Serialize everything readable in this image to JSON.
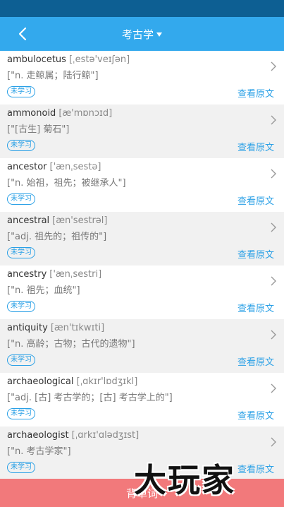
{
  "colors": {
    "status_bar": "#0d5f93",
    "nav_bar": "#33a9ed",
    "accent": "#2aa0e6",
    "bottom_button": "#f2797b",
    "alt_row": "#f1f1f1"
  },
  "nav": {
    "title": "考古学",
    "back_icon": "chevron-left-icon",
    "dropdown_icon": "caret-down-icon"
  },
  "words": [
    {
      "word": "ambulocetus",
      "phonetic": "[ˌestə'veɪʃən]",
      "meaning": "[\"n. 走鲸属；陆行鲸\"]",
      "status": "未学习",
      "link": "查看原文"
    },
    {
      "word": "ammonoid",
      "phonetic": "[æ'mɒnɔɪd]",
      "meaning": "[\"[古生] 菊石\"]",
      "status": "未学习",
      "link": "查看原文"
    },
    {
      "word": "ancestor",
      "phonetic": "['ænˌsestə]",
      "meaning": "[\"n. 始祖，祖先；被继承人\"]",
      "status": "未学习",
      "link": "查看原文"
    },
    {
      "word": "ancestral",
      "phonetic": "[æn'sestrəl]",
      "meaning": "[\"adj. 祖先的；祖传的\"]",
      "status": "未学习",
      "link": "查看原文"
    },
    {
      "word": "ancestry",
      "phonetic": "['ænˌsestri]",
      "meaning": "[\"n. 祖先；血统\"]",
      "status": "未学习",
      "link": "查看原文"
    },
    {
      "word": "antiquity",
      "phonetic": "[æn'tɪkwɪti]",
      "meaning": "[\"n. 高龄；古物；古代的遗物\"]",
      "status": "未学习",
      "link": "查看原文"
    },
    {
      "word": "archaeological",
      "phonetic": "[ˌɑkɪr'lɒdʒɪkl]",
      "meaning": "[\"adj. [古] 考古学的；[古] 考古学上的\"]",
      "status": "未学习",
      "link": "查看原文"
    },
    {
      "word": "archaeologist",
      "phonetic": "[ˌɑrkɪ'ɑlədʒɪst]",
      "meaning": "[\"n. 考古学家\"]",
      "status": "未学习",
      "link": "查看原文"
    }
  ],
  "bottom": {
    "label": "背单词"
  },
  "watermark": {
    "text": "大玩家"
  }
}
